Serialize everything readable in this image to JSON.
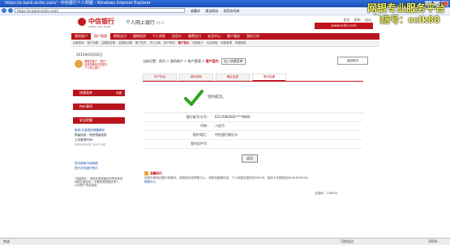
{
  "window": {
    "title": "https://e.bank.ecitic.com/ - 中信银行个人网银 - Windows Internet Explorer"
  },
  "watermark": {
    "line1": "网银专业服务平台",
    "line2": "微信号：cclk88"
  },
  "browser": {
    "url": "https://e.bank.ecitic.com/",
    "toolbar": [
      "收藏夹",
      "建议网站",
      "网页快讯库"
    ]
  },
  "header": {
    "bank_cn": "中信银行",
    "bank_en": "CHINA CITIC BANK",
    "product": "个人网上银行",
    "version": "V5.4",
    "links": [
      "首页",
      "帮助",
      "退出"
    ],
    "site": "www.ecitic.com"
  },
  "mainnav": [
    "我的账户",
    "账户管理",
    "转账支付",
    "理财投资",
    "个人贷款",
    "信用卡",
    "缴费支付",
    "安全中心",
    "客户服务",
    "我的工作"
  ],
  "mainnav_active": 1,
  "subnav": [
    "余额查询",
    "账户余额",
    "活期转定期",
    "定期转活期",
    "账户挂失",
    "外汇买卖",
    "账户资料",
    "账户签约",
    "存款账户",
    "约定转账",
    "转账管理",
    "网银转账",
    "银行卡管理"
  ],
  "subnav_active": 7,
  "sidebar": {
    "date": "2015年03月02日",
    "user_text": [
      "尊敬的客户：您好！",
      "欢迎您使用中信银行",
      "个人网上银行"
    ],
    "sections": [
      {
        "label": "快捷菜单",
        "action": "设置"
      },
      {
        "label": "待办事项",
        "action": ""
      },
      {
        "label": "安全提醒",
        "action": ""
      }
    ],
    "security_items": [
      "登录/交易短信提醒服务",
      "预留信息：您的预留信息",
      "上次登录时间：",
      "2015-03-02 10:17:42"
    ],
    "links": [
      "您可使用中信网银",
      "进行手机银行签约"
    ],
    "note": "*温馨提示：请您妥善保管好您的登录密码和交易密码，不要轻易透露给他人，以防账户资金被盗。"
  },
  "content": {
    "breadcrumb_prefix": "当前位置：首页 > 我的账户 > 账户管理 > ",
    "breadcrumb_current": "客户签约",
    "breadcrumb_tag": "加入快捷菜单",
    "right_button": "返回首页",
    "tabs": [
      "开户协议",
      "填写资料",
      "确认信息",
      "签约结果"
    ],
    "active_tab": 3,
    "success_message": "签约成功。",
    "details": [
      {
        "label": "银行账号/卡号：",
        "value": "6217680000****6806"
      },
      {
        "label": "币种：",
        "value": "人民币"
      },
      {
        "label": "现钞/现汇：",
        "value": "中信银行借记卡"
      },
      {
        "label": "签约证件号：",
        "value": ""
      }
    ],
    "ok_button": "返回",
    "tip_title": "温馨提示：",
    "tip_body": "如您在使用过程中有疑问，请咨询在线帮助中心，或致电客服热线，个人网银全国热线95558，信用卡全国热线4008-895558。",
    "tip_highlight": "帮助中心",
    "page_no": "交易码：228004"
  },
  "statusbar": {
    "done": "完成",
    "zone": "可信站点",
    "zoom": "100%"
  }
}
